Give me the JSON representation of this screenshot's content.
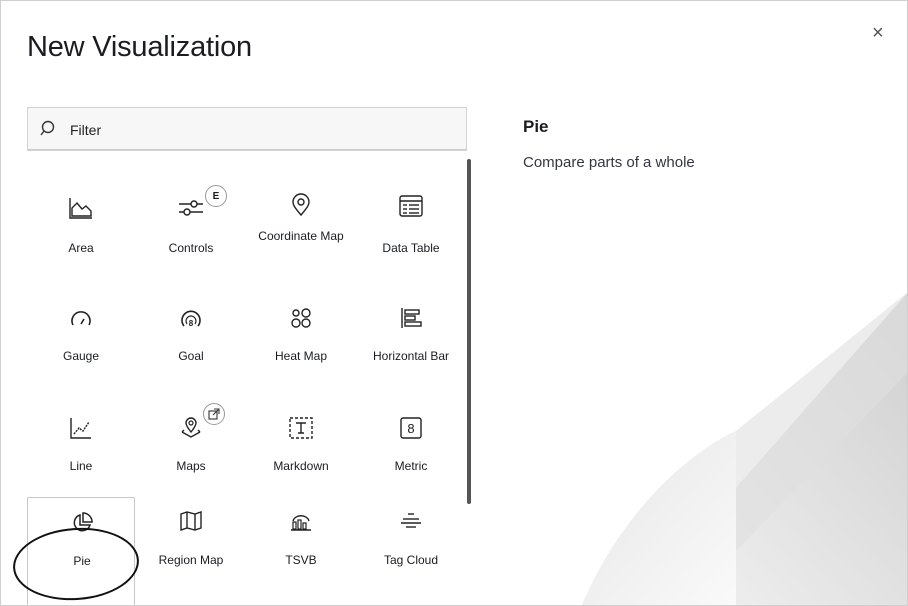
{
  "modal": {
    "title": "New Visualization",
    "close_glyph": "×"
  },
  "search": {
    "placeholder": "Filter",
    "icon": "search-icon"
  },
  "tiles": [
    {
      "label": "Area",
      "icon": "area-chart-icon"
    },
    {
      "label": "Controls",
      "icon": "controls-icon",
      "badge": "E"
    },
    {
      "label": "Coordinate Map",
      "icon": "map-marker-icon"
    },
    {
      "label": "Data Table",
      "icon": "table-icon"
    },
    {
      "label": "Gauge",
      "icon": "gauge-icon"
    },
    {
      "label": "Goal",
      "icon": "goal-icon"
    },
    {
      "label": "Heat Map",
      "icon": "heatmap-icon"
    },
    {
      "label": "Horizontal Bar",
      "icon": "horizontal-bar-icon"
    },
    {
      "label": "Line",
      "icon": "line-chart-icon"
    },
    {
      "label": "Maps",
      "icon": "maps-icon",
      "badge": "external-link-icon"
    },
    {
      "label": "Markdown",
      "icon": "markdown-icon"
    },
    {
      "label": "Metric",
      "icon": "metric-icon",
      "glyph": "8"
    },
    {
      "label": "Pie",
      "icon": "pie-chart-icon",
      "selected": true
    },
    {
      "label": "Region Map",
      "icon": "region-map-icon"
    },
    {
      "label": "TSVB",
      "icon": "tsvb-icon"
    },
    {
      "label": "Tag Cloud",
      "icon": "tag-cloud-icon"
    }
  ],
  "description": {
    "title": "Pie",
    "text": "Compare parts of a whole"
  },
  "colors": {
    "text": "#1a1c21",
    "border": "#d3d3d3",
    "annotation": "#111111"
  }
}
